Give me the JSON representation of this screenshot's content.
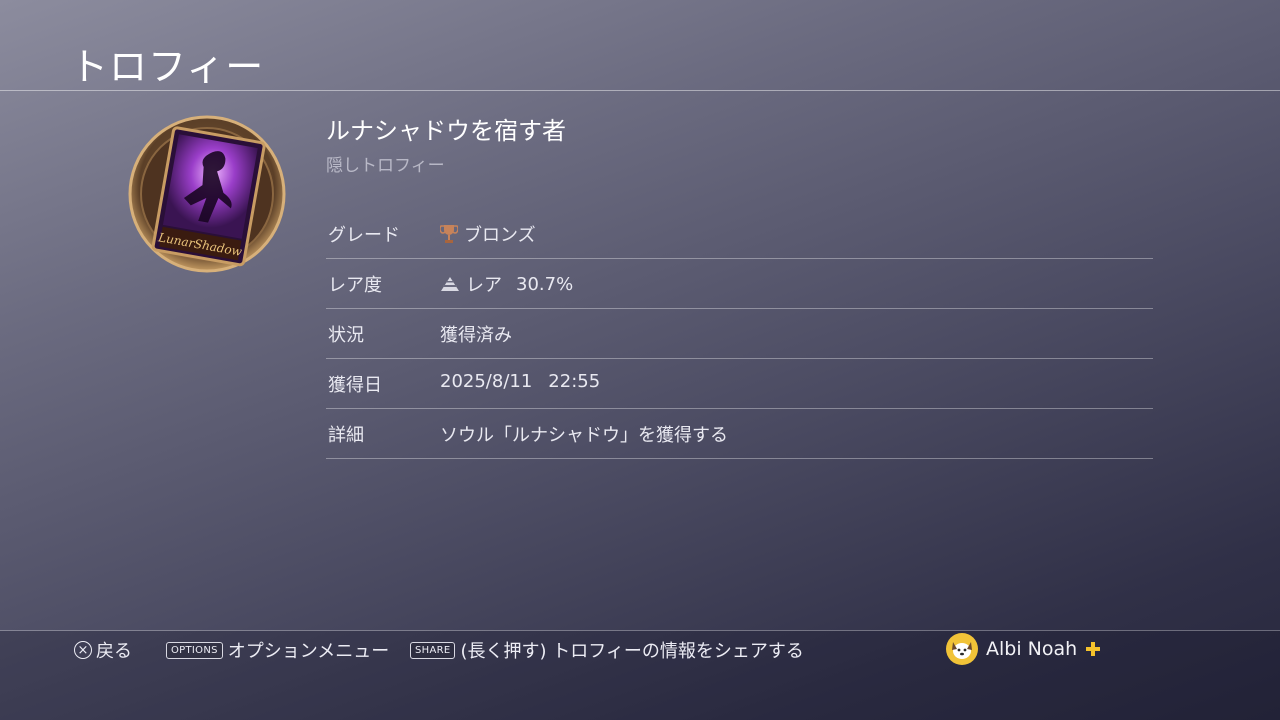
{
  "header": {
    "title": "トロフィー"
  },
  "trophy": {
    "name": "ルナシャドウを宿す者",
    "hidden_label": "隠しトロフィー",
    "art_text": "LunarShadow"
  },
  "details": {
    "grade": {
      "label": "グレード",
      "value": "ブロンズ",
      "icon": "bronze-trophy-icon"
    },
    "rarity": {
      "label": "レア度",
      "value": "レア",
      "percent": "30.7%",
      "icon": "rarity-pyramid-icon"
    },
    "status": {
      "label": "状況",
      "value": "獲得済み"
    },
    "earned": {
      "label": "獲得日",
      "date": "2025/8/11",
      "time": "22:55"
    },
    "description": {
      "label": "詳細",
      "value": "ソウル「ルナシャドウ」を獲得する"
    }
  },
  "footer": {
    "back": {
      "button": "×",
      "label": "戻る"
    },
    "options": {
      "key": "OPTIONS",
      "label": "オプションメニュー"
    },
    "share": {
      "key": "SHARE",
      "label": "(長く押す) トロフィーの情報をシェアする"
    }
  },
  "user": {
    "name": "Albi Noah"
  },
  "colors": {
    "bronze": "#c7835a",
    "plus": "#f4c22c",
    "avatar": "#f1c338"
  }
}
